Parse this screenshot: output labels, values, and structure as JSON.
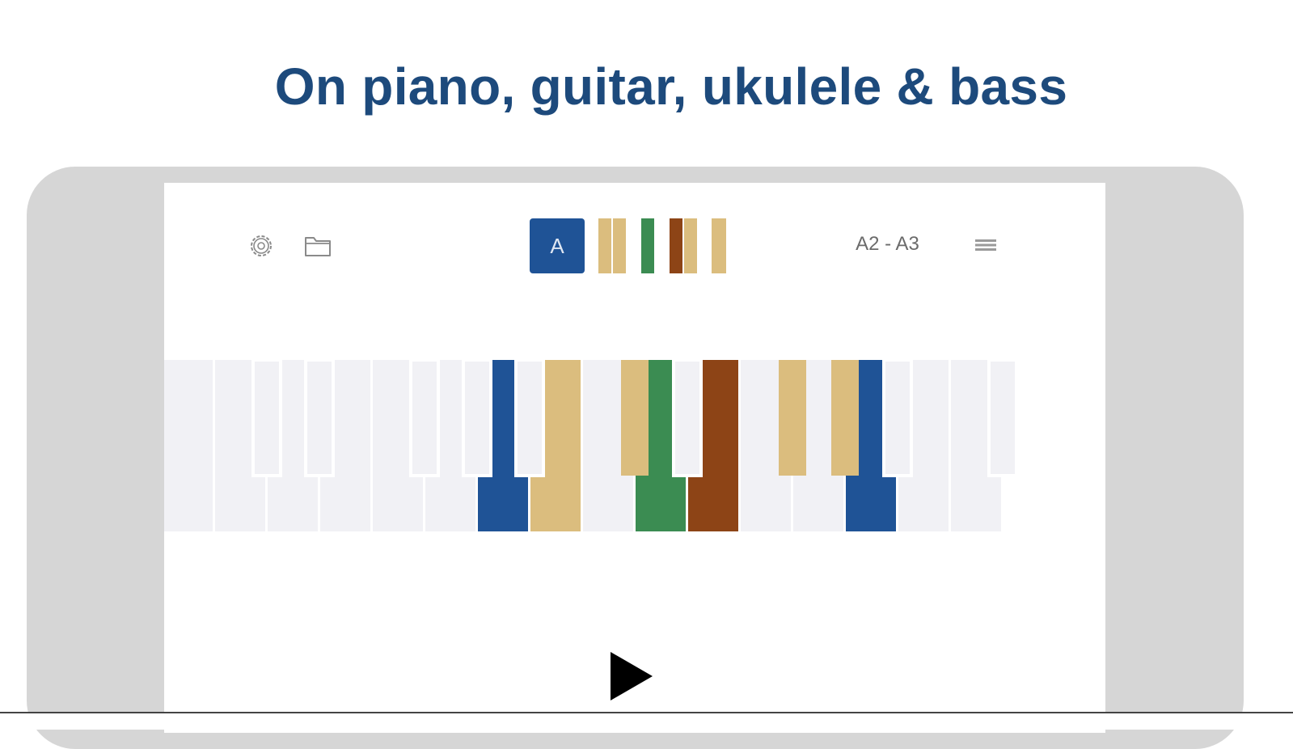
{
  "headline": "On piano, guitar, ukulele & bass",
  "toolbar": {
    "settings_icon": "gear-icon",
    "open_icon": "folder-icon",
    "key_label": "A",
    "range_label": "A2 - A3",
    "menu_icon": "menu-icon"
  },
  "colors": {
    "headline": "#1d4a7c",
    "root": "#1f5396",
    "scale_tone": "#dbbd7e",
    "highlight_green": "#3b8c52",
    "highlight_brown": "#8d4416",
    "key_off": "#f1f1f5",
    "device_frame": "#d6d6d6"
  },
  "keyboard": {
    "highlighted_keys": [
      {
        "note": "A2",
        "role": "root"
      },
      {
        "note": "B2",
        "role": "scale_tone"
      },
      {
        "note": "C#3",
        "role": "scale_tone"
      },
      {
        "note": "D3",
        "role": "highlight_green"
      },
      {
        "note": "E3",
        "role": "highlight_brown"
      },
      {
        "note": "F#3",
        "role": "scale_tone"
      },
      {
        "note": "G#3",
        "role": "scale_tone"
      },
      {
        "note": "A3",
        "role": "root"
      }
    ]
  },
  "player": {
    "play_icon": "play-icon"
  }
}
